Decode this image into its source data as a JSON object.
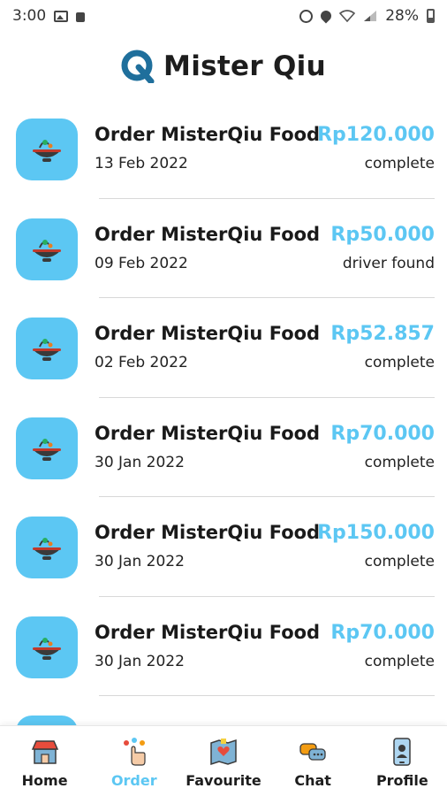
{
  "status_bar": {
    "time": "3:00",
    "battery": "28%",
    "icons": [
      "image-icon",
      "bag-icon",
      "alarm-icon",
      "location-icon",
      "wifi-icon",
      "signal-icon",
      "battery-icon"
    ]
  },
  "header": {
    "title": "Mister Qiu",
    "logo_icon": "q-logo-icon"
  },
  "colors": {
    "accent": "#5cc7f3",
    "text": "#1a1a1a"
  },
  "orders": [
    {
      "title": "Order MisterQiu Food",
      "date": "13 Feb 2022",
      "price": "Rp120.000",
      "status": "complete",
      "icon": "food-wok-icon"
    },
    {
      "title": "Order MisterQiu Food",
      "date": "09 Feb 2022",
      "price": "Rp50.000",
      "status": "driver found",
      "icon": "food-wok-icon"
    },
    {
      "title": "Order MisterQiu Food",
      "date": "02 Feb 2022",
      "price": "Rp52.857",
      "status": "complete",
      "icon": "food-wok-icon"
    },
    {
      "title": "Order MisterQiu Food",
      "date": "30 Jan 2022",
      "price": "Rp70.000",
      "status": "complete",
      "icon": "food-wok-icon"
    },
    {
      "title": "Order MisterQiu Food",
      "date": "30 Jan 2022",
      "price": "Rp150.000",
      "status": "complete",
      "icon": "food-wok-icon"
    },
    {
      "title": "Order MisterQiu Food",
      "date": "30 Jan 2022",
      "price": "Rp70.000",
      "status": "complete",
      "icon": "food-wok-icon"
    }
  ],
  "bottom_nav": [
    {
      "label": "Home",
      "icon": "store-icon",
      "active": false
    },
    {
      "label": "Order",
      "icon": "order-tap-icon",
      "active": true
    },
    {
      "label": "Favourite",
      "icon": "favourite-map-icon",
      "active": false
    },
    {
      "label": "Chat",
      "icon": "chat-bubbles-icon",
      "active": false
    },
    {
      "label": "Profile",
      "icon": "profile-phone-icon",
      "active": false
    }
  ]
}
